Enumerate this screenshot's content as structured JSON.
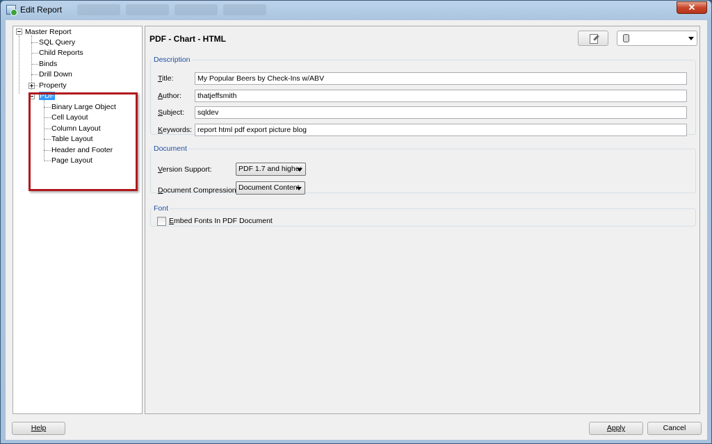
{
  "window": {
    "title": "Edit Report",
    "close_glyph": "✕"
  },
  "tree": {
    "root": "Master Report",
    "children": [
      "SQL Query",
      "Child Reports",
      "Binds",
      "Drill Down",
      "Property"
    ],
    "selected": "PDF",
    "pdf_children": [
      "Binary Large Object",
      "Cell Layout",
      "Column Layout",
      "Table Layout",
      "Header and Footer",
      "Page Layout"
    ]
  },
  "content": {
    "title": "PDF - Chart - HTML",
    "toolbar": {
      "edit_icon": "edit-document-icon",
      "connection_icon": "database-icon",
      "connection_value": ""
    },
    "description": {
      "legend": "Description",
      "title_label_key": "T",
      "title_label_rest": "itle:",
      "title_value": "My Popular Beers by Check-Ins w/ABV",
      "author_label_key": "A",
      "author_label_rest": "uthor:",
      "author_value": "thatjeffsmith",
      "subject_label_key": "S",
      "subject_label_rest": "ubject:",
      "subject_value": "sqldev",
      "keywords_label_key": "K",
      "keywords_label_rest": "eywords:",
      "keywords_value": "report html pdf export picture blog"
    },
    "document": {
      "legend": "Document",
      "version_label_key": "V",
      "version_label_rest": "ersion Support:",
      "version_value": "PDF 1.7 and higher",
      "compression_label_key": "D",
      "compression_label_rest": "ocument Compression:",
      "compression_value": "Document Content"
    },
    "font": {
      "legend": "Font",
      "embed_label_key": "E",
      "embed_label_rest": "mbed Fonts In PDF Document",
      "embed_checked": false
    }
  },
  "buttons": {
    "help": "Help",
    "apply": "Apply",
    "cancel": "Cancel"
  },
  "colors": {
    "selection": "#3399ff",
    "highlight_box": "#b1181c",
    "legend_text": "#1e4fa0"
  }
}
